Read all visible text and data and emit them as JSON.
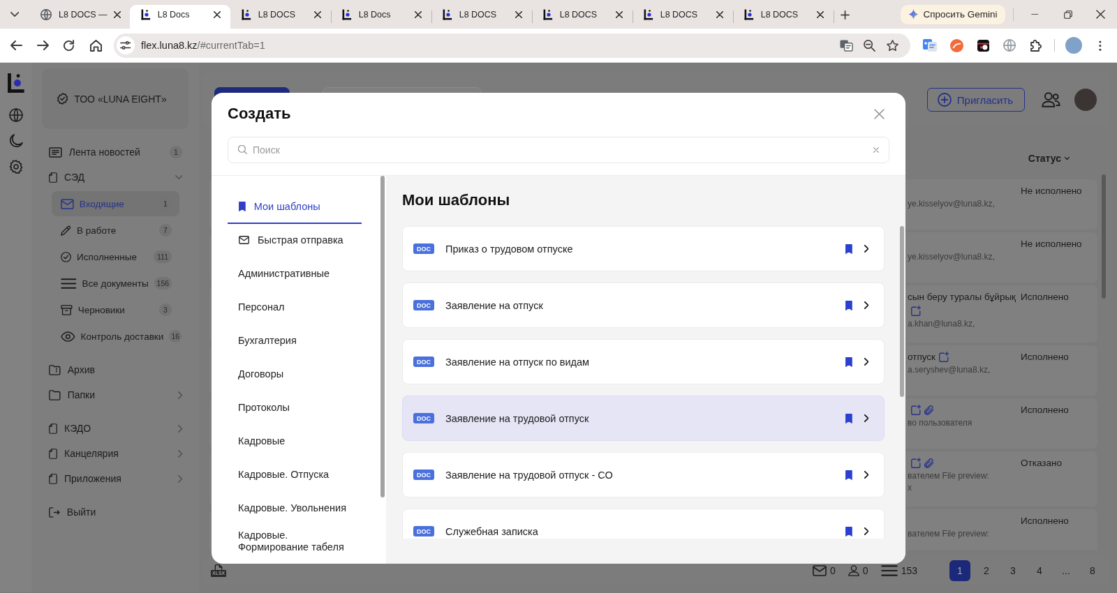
{
  "browser": {
    "tabs": [
      {
        "title": "L8 DOCS —",
        "kind": "web",
        "selected": false
      },
      {
        "title": "L8 Docs",
        "kind": "app",
        "selected": true
      },
      {
        "title": "L8 DOCS",
        "kind": "app",
        "selected": false
      },
      {
        "title": "L8 Docs",
        "kind": "app",
        "selected": false
      },
      {
        "title": "L8 DOCS",
        "kind": "app",
        "selected": false
      },
      {
        "title": "L8 DOCS",
        "kind": "app",
        "selected": false
      },
      {
        "title": "L8 DOCS",
        "kind": "app",
        "selected": false
      },
      {
        "title": "L8 DOCS",
        "kind": "app",
        "selected": false
      }
    ],
    "assistant_button": {
      "label": "Спросить Gemini"
    },
    "address_bar": {
      "host": "flex.luna8.kz",
      "path": "/#currentTab=1"
    }
  },
  "sidebar": {
    "company": "ТОО «LUNA EIGHT»",
    "groups": [
      [
        {
          "label": "Лента новостей",
          "kind": "feed",
          "count": "1",
          "selected": false
        },
        {
          "label": "СЭД",
          "kind": "module",
          "expanded": true,
          "selected": false,
          "children": [
            {
              "label": "Входящие",
              "kind": "inbox",
              "count": "1",
              "selected": true
            },
            {
              "label": "В работе",
              "kind": "work",
              "count": "7",
              "selected": false
            },
            {
              "label": "Исполненные",
              "kind": "done",
              "count": "111",
              "selected": false
            },
            {
              "label": "Все документы",
              "kind": "all",
              "count": "156",
              "selected": false
            },
            {
              "label": "Черновики",
              "kind": "drafts",
              "count": "3",
              "selected": false
            },
            {
              "label": "Контроль доставки",
              "kind": "delivery",
              "count": "16",
              "selected": false
            }
          ]
        }
      ],
      [
        {
          "label": "Архив",
          "kind": "archive",
          "selected": false
        },
        {
          "label": "Папки",
          "kind": "folders",
          "expanded": false,
          "selected": false
        }
      ],
      [
        {
          "label": "КЭДО",
          "kind": "module",
          "expanded": false,
          "selected": false
        },
        {
          "label": "Канцелярия",
          "kind": "module",
          "expanded": false,
          "selected": false
        },
        {
          "label": "Приложения",
          "kind": "module",
          "expanded": false,
          "selected": false
        }
      ],
      [
        {
          "label": "Выйти",
          "kind": "logout",
          "selected": false
        }
      ]
    ]
  },
  "header": {
    "invite_button": "Пригласить"
  },
  "table": {
    "columns": [
      {
        "label": "Статус"
      }
    ],
    "rows": [
      {
        "details": [
          "ye.kisselyov@luna8.kz,"
        ],
        "marked": false,
        "attachment": false,
        "status": "Не исполнено"
      },
      {
        "details": [
          "ye.kisselyov@luna8.kz,"
        ],
        "marked": false,
        "attachment": false,
        "status": "Не исполнено"
      },
      {
        "title": "сын беру туралы бұйрық",
        "marked": true,
        "attachment": false,
        "details": [
          "a.khan@luna8.kz,"
        ],
        "status": "Исполнено"
      },
      {
        "title": "отпуск",
        "marked": true,
        "attachment": false,
        "details": [
          "a.seryshev@luna8.kz,"
        ],
        "status": "Исполнено"
      },
      {
        "marked": true,
        "attachment": true,
        "details": [
          "во пользователя"
        ],
        "status": "Исполнено"
      },
      {
        "marked": true,
        "attachment": true,
        "details": [
          "вателем File preview:",
          "x"
        ],
        "status": "Отказано"
      },
      {
        "marked": false,
        "attachment": false,
        "details": [
          "вателем File preview:"
        ],
        "status": "Исполнено"
      }
    ]
  },
  "footer": {
    "export_label": "XLSX",
    "counters": [
      {
        "kind": "mail",
        "value": "0"
      },
      {
        "kind": "people",
        "value": "0"
      },
      {
        "kind": "total",
        "value": "153"
      }
    ],
    "pages": [
      {
        "label": "1",
        "selected": true
      },
      {
        "label": "2",
        "selected": false
      },
      {
        "label": "3",
        "selected": false
      },
      {
        "label": "4",
        "selected": false
      },
      {
        "label": "...",
        "selected": false
      },
      {
        "label": "8",
        "selected": false
      }
    ]
  },
  "modal": {
    "title": "Создать",
    "search": {
      "placeholder": "Поиск"
    },
    "categories": [
      {
        "label": "Мои шаблоны",
        "kind": "saved",
        "selected": true
      },
      {
        "label": "Быстрая отправка",
        "kind": "quick",
        "selected": false
      },
      {
        "label": "Административные",
        "kind": "group",
        "selected": false
      },
      {
        "label": "Персонал",
        "kind": "group",
        "selected": false
      },
      {
        "label": "Бухгалтерия",
        "kind": "group",
        "selected": false
      },
      {
        "label": "Договоры",
        "kind": "group",
        "selected": false
      },
      {
        "label": "Протоколы",
        "kind": "group",
        "selected": false
      },
      {
        "label": "Кадровые",
        "kind": "group",
        "selected": false
      },
      {
        "label": "Кадровые. Отпуска",
        "kind": "group",
        "selected": false
      },
      {
        "label": "Кадровые. Увольнения",
        "kind": "group",
        "selected": false
      },
      {
        "label": "Кадровые. Формирование табеля",
        "kind": "group",
        "selected": false
      }
    ],
    "heading": "Мои шаблоны",
    "templates": [
      {
        "badge": "DOC",
        "title": "Приказ о трудовом отпуске",
        "bookmarked": true,
        "selected": false
      },
      {
        "badge": "DOC",
        "title": "Заявление на отпуск",
        "bookmarked": true,
        "selected": false
      },
      {
        "badge": "DOC",
        "title": "Заявление на отпуск по видам",
        "bookmarked": true,
        "selected": false
      },
      {
        "badge": "DOC",
        "title": "Заявление на трудовой отпуск",
        "bookmarked": true,
        "selected": true
      },
      {
        "badge": "DOC",
        "title": "Заявление на трудовой отпуск - СО",
        "bookmarked": true,
        "selected": false
      },
      {
        "badge": "DOC",
        "title": "Служебная записка",
        "bookmarked": true,
        "selected": false
      }
    ]
  }
}
